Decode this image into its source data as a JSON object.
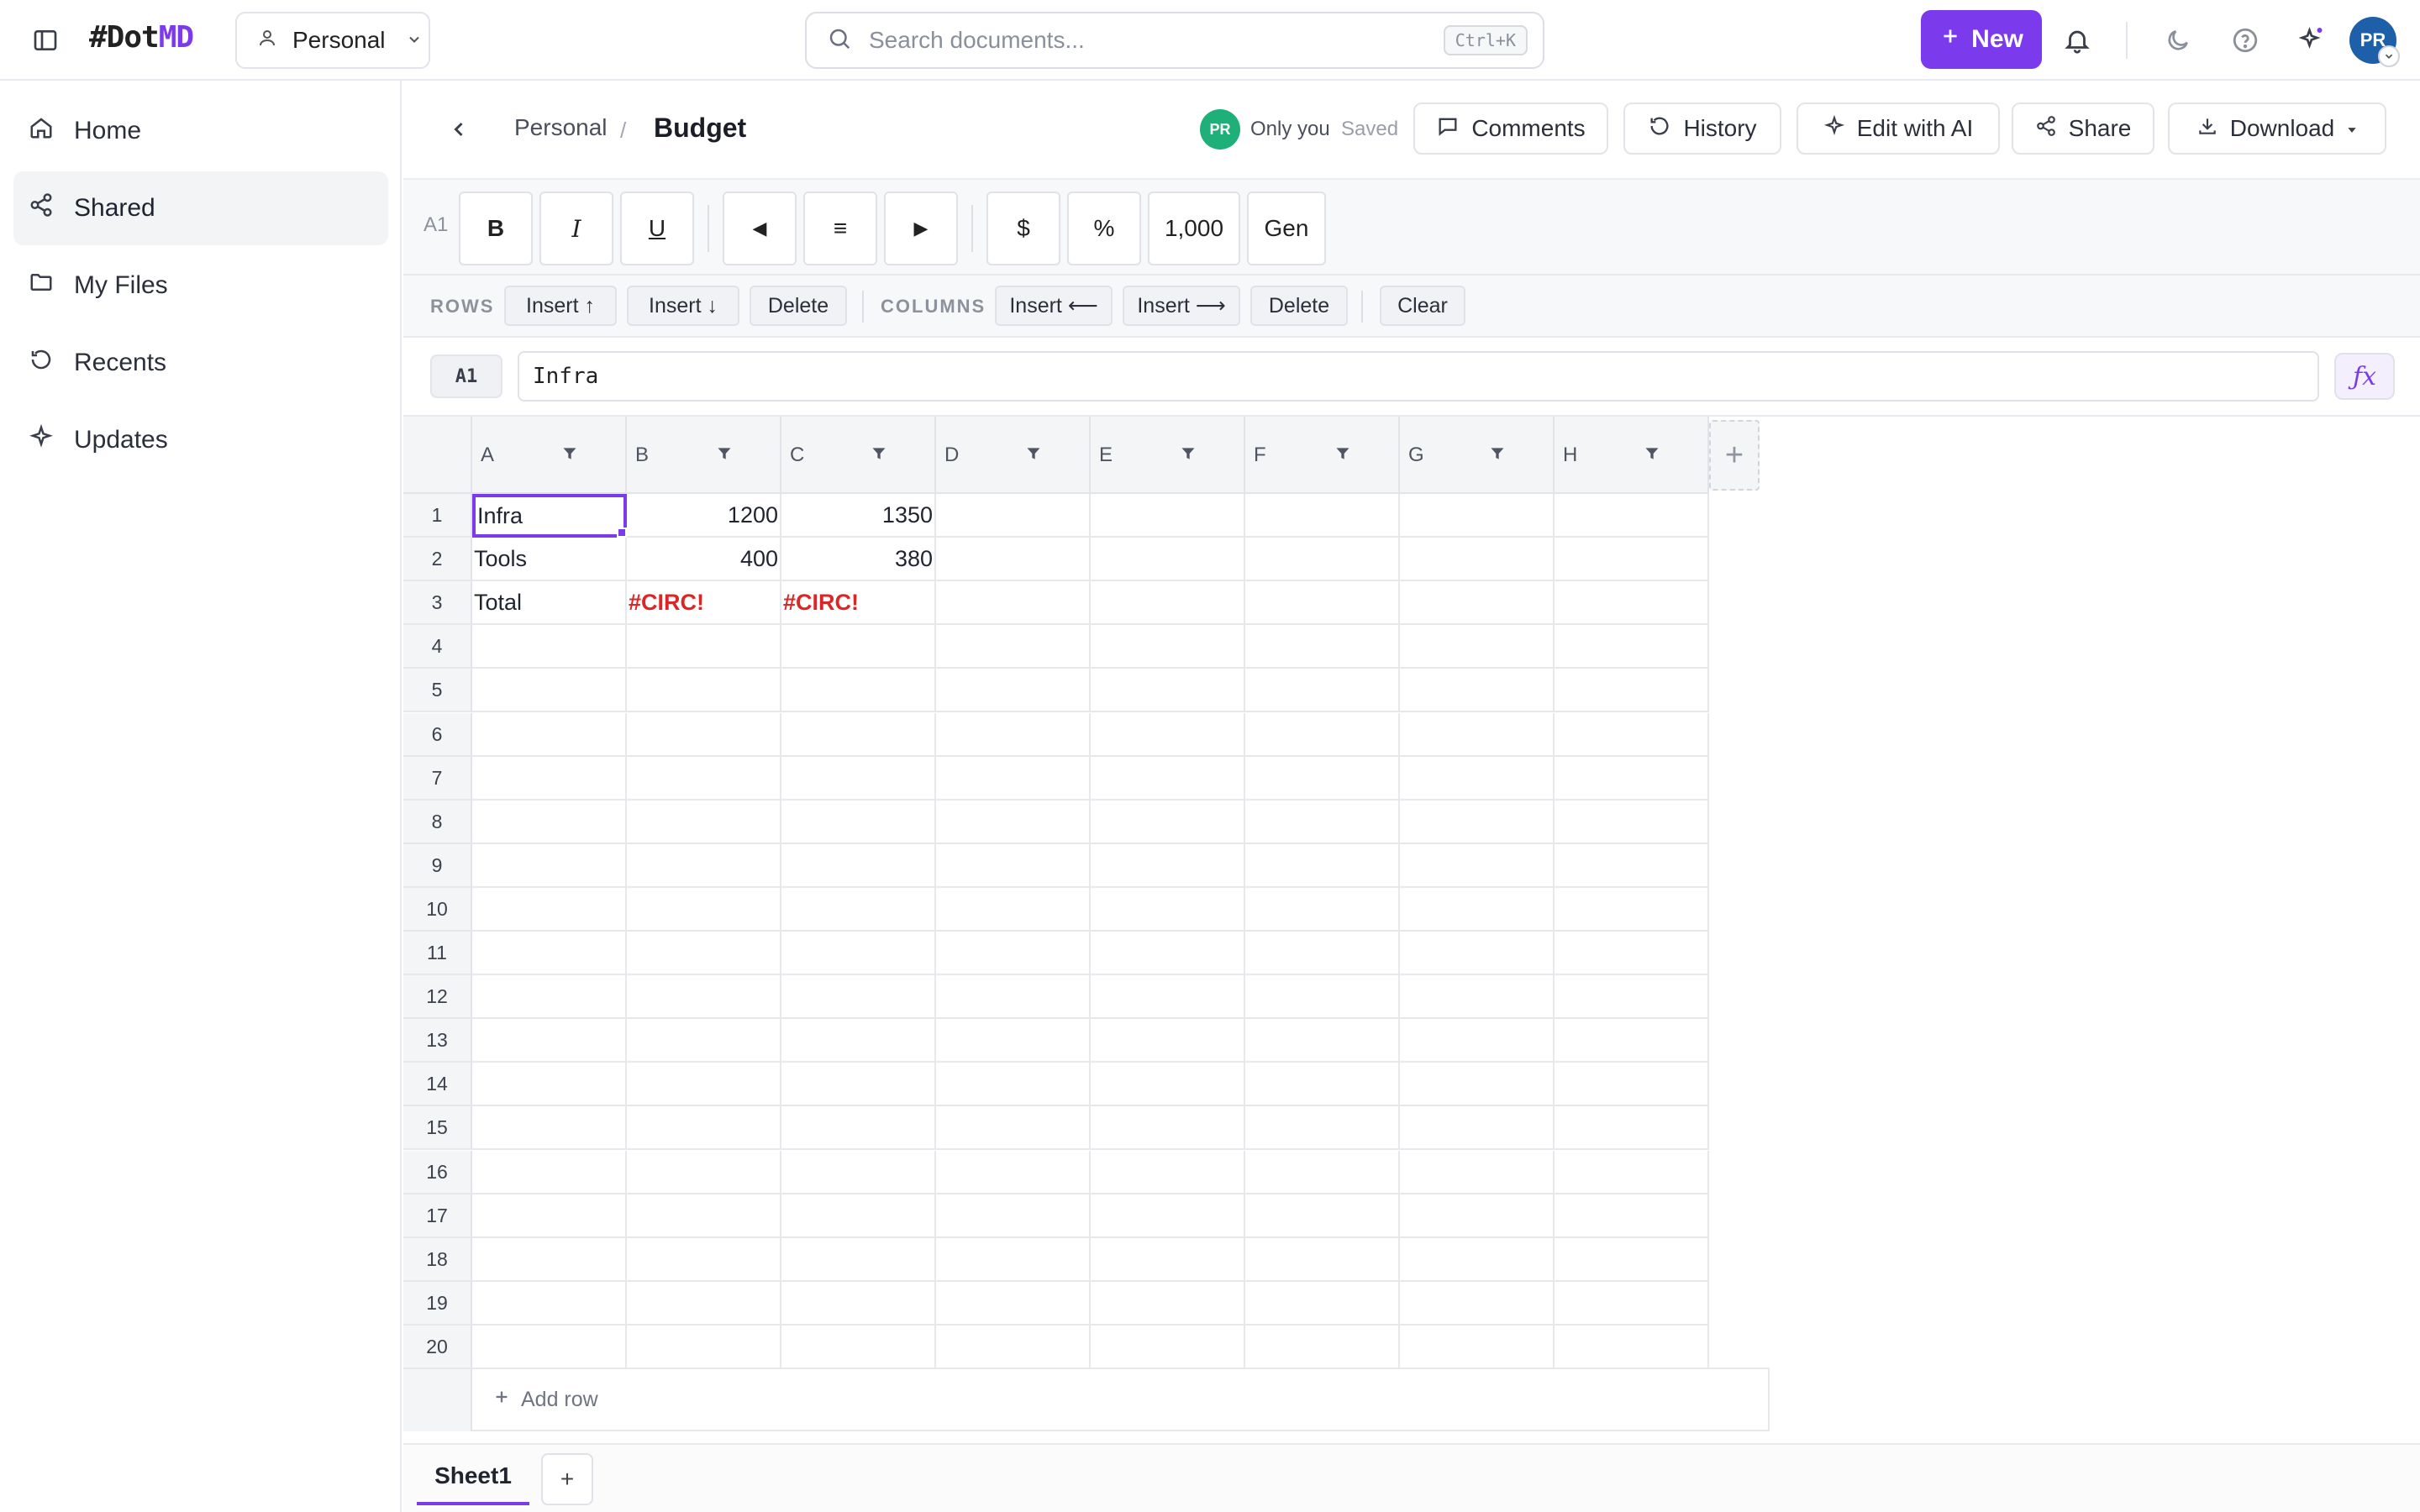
{
  "app": {
    "logo_prefix": "#Dot",
    "logo_suffix": "MD",
    "workspace": "Personal",
    "search_placeholder": "Search documents...",
    "search_shortcut": "Ctrl+K",
    "new_label": "New",
    "user_initials": "PR",
    "accent_color": "#7c3aed"
  },
  "sidebar": {
    "items": [
      {
        "label": "Home",
        "icon": "home-icon",
        "active": false
      },
      {
        "label": "Shared",
        "icon": "share-icon",
        "active": true
      },
      {
        "label": "My Files",
        "icon": "folder-icon",
        "active": false
      },
      {
        "label": "Recents",
        "icon": "history-icon",
        "active": false
      },
      {
        "label": "Updates",
        "icon": "sparkle-icon",
        "active": false
      }
    ]
  },
  "document": {
    "breadcrumb_parent": "Personal",
    "breadcrumb_sep": "/",
    "title": "Budget",
    "owner_initials": "PR",
    "visibility": "Only you",
    "save_status": "Saved",
    "actions": {
      "comments": "Comments",
      "history": "History",
      "edit_ai": "Edit with AI",
      "share": "Share",
      "download": "Download"
    }
  },
  "format_toolbar": {
    "cell_ref": "A1",
    "bold": "B",
    "italic": "I",
    "underline": "U",
    "align_left": "◀",
    "align_center": "≡",
    "align_right": "▶",
    "currency": "$",
    "percent": "%",
    "thousands": "1,000",
    "general": "Gen"
  },
  "rc_toolbar": {
    "rows_label": "ROWS",
    "insert_above": "Insert ↑",
    "insert_below": "Insert ↓",
    "delete_row": "Delete",
    "columns_label": "COLUMNS",
    "insert_left": "Insert ⟵",
    "insert_right": "Insert ⟶",
    "delete_col": "Delete",
    "clear": "Clear"
  },
  "formula_bar": {
    "name_box": "A1",
    "value": "Infra",
    "fx": "ƒx"
  },
  "sheet": {
    "columns": [
      "A",
      "B",
      "C",
      "D",
      "E",
      "F",
      "G",
      "H"
    ],
    "row_count": 20,
    "selected_cell": "A1",
    "cells": [
      [
        "Infra",
        "1200",
        "1350",
        "",
        "",
        "",
        "",
        ""
      ],
      [
        "Tools",
        "400",
        "380",
        "",
        "",
        "",
        "",
        ""
      ],
      [
        "Total",
        "#CIRC!",
        "#CIRC!",
        "",
        "",
        "",
        "",
        ""
      ]
    ],
    "add_row_label": "Add row",
    "add_column_label": "+",
    "error_color": "#dc2626"
  },
  "sheet_tabs": {
    "tabs": [
      "Sheet1"
    ],
    "active": "Sheet1",
    "add_label": "+"
  }
}
